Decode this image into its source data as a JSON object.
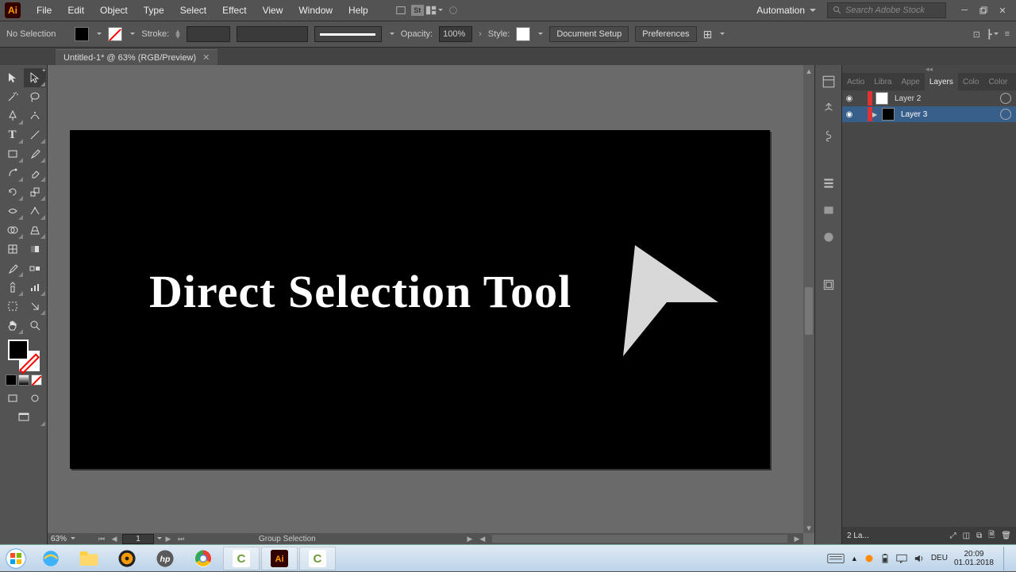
{
  "app": {
    "logo": "Ai"
  },
  "menu": [
    "File",
    "Edit",
    "Object",
    "Type",
    "Select",
    "Effect",
    "View",
    "Window",
    "Help"
  ],
  "workspace_switcher": "Automation",
  "stock_search_placeholder": "Search Adobe Stock",
  "controlbar": {
    "selection": "No Selection",
    "stroke_label": "Stroke:",
    "opacity_label": "Opacity:",
    "opacity_value": "100%",
    "style_label": "Style:",
    "doc_setup": "Document Setup",
    "preferences": "Preferences"
  },
  "document_tab": "Untitled-1* @ 63% (RGB/Preview)",
  "artboard_text": "Direct Selection Tool",
  "statusbar": {
    "zoom": "63%",
    "page": "1",
    "status": "Group Selection"
  },
  "panel_tabs": [
    "Actio",
    "Libra",
    "Appe",
    "Layers",
    "Colo",
    "Color"
  ],
  "active_panel_tab": 3,
  "layers": [
    {
      "name": "Layer 2",
      "thumb": "white",
      "selected": false
    },
    {
      "name": "Layer 3",
      "thumb": "art",
      "selected": true,
      "expandable": true
    }
  ],
  "layers_footer": "2 La...",
  "taskbar": {
    "lang": "DEU",
    "time": "20:09",
    "date": "01.01.2018"
  }
}
